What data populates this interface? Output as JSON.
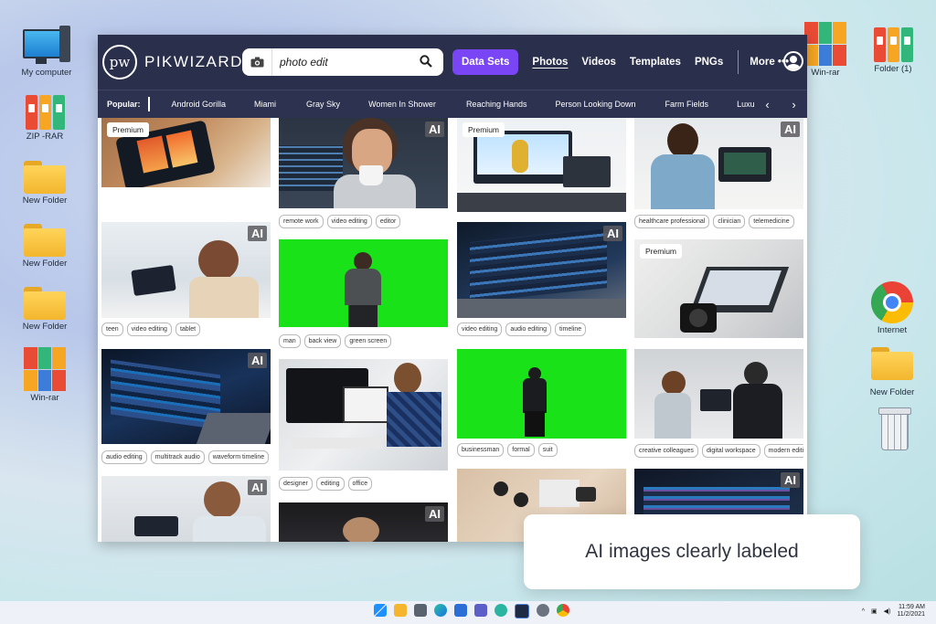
{
  "desktop": {
    "left_icons": [
      {
        "label": "My computer",
        "icon": "computer-icon"
      },
      {
        "label": "ZIP -RAR",
        "icon": "binders-icon"
      },
      {
        "label": "New Folder",
        "icon": "folder-icon"
      },
      {
        "label": "New Folder",
        "icon": "folder-icon"
      },
      {
        "label": "New Folder",
        "icon": "folder-icon"
      },
      {
        "label": "Win-rar",
        "icon": "winrar-icon"
      }
    ],
    "right_icons": [
      {
        "label": "Win-rar",
        "icon": "winrar-icon"
      },
      {
        "label": "Folder (1)",
        "icon": "binders-icon"
      },
      {
        "label": "Internet",
        "icon": "chrome-icon"
      },
      {
        "label": "New Folder",
        "icon": "folder-icon"
      },
      {
        "label": "",
        "icon": "recycle-bin-icon"
      }
    ]
  },
  "site": {
    "logo_text": "pw",
    "brand": "PIKWIZARD",
    "search": {
      "value": "photo edit",
      "icons": [
        "camera-icon",
        "search-icon"
      ]
    },
    "datasets_label": "Data Sets",
    "nav": [
      {
        "label": "Photos",
        "active": true
      },
      {
        "label": "Videos",
        "active": false
      },
      {
        "label": "Templates",
        "active": false
      },
      {
        "label": "PNGs",
        "active": false
      }
    ],
    "more_label": "More •••",
    "popular_label": "Popular:",
    "popular_tags": [
      "Android Gorilla",
      "Miami",
      "Gray Sky",
      "Women In Shower",
      "Reaching Hands",
      "Person Looking Down",
      "Farm Fields",
      "Luxu"
    ],
    "arrows": {
      "prev": "‹",
      "next": "›"
    }
  },
  "cards": {
    "c1": {
      "badge": "Premium"
    },
    "c2": {
      "badge": "AI",
      "tags": [
        "teen",
        "video editing",
        "tablet"
      ]
    },
    "c3": {
      "badge": "AI",
      "tags": [
        "audio editing",
        "multitrack audio",
        "waveform timeline"
      ]
    },
    "c4": {
      "badge": "AI"
    },
    "c5": {
      "badge": "AI",
      "tags": [
        "remote work",
        "video editing",
        "editor"
      ]
    },
    "c6": {
      "badge": "",
      "tags": [
        "man",
        "back view",
        "green screen"
      ]
    },
    "c7": {
      "badge": "",
      "tags": [
        "designer",
        "editing",
        "office"
      ]
    },
    "c8": {
      "badge": "AI"
    },
    "c9": {
      "badge": "Premium"
    },
    "c10": {
      "badge": "AI",
      "tags": [
        "video editing",
        "audio editing",
        "timeline"
      ]
    },
    "c11": {
      "badge": "",
      "tags": [
        "businessman",
        "formal",
        "suit"
      ]
    },
    "c12": {
      "badge": ""
    },
    "c13": {
      "badge": "AI",
      "tags": [
        "healthcare professional",
        "clinician",
        "telemedicine"
      ]
    },
    "c14": {
      "badge": "Premium"
    },
    "c15": {
      "badge": "",
      "tags": [
        "creative colleagues",
        "digital workspace",
        "modern editing studio"
      ]
    },
    "c16": {
      "badge": "AI"
    }
  },
  "toast": "AI images clearly labeled",
  "taskbar": {
    "time": "11:59 AM",
    "date": "11/2/2021"
  }
}
